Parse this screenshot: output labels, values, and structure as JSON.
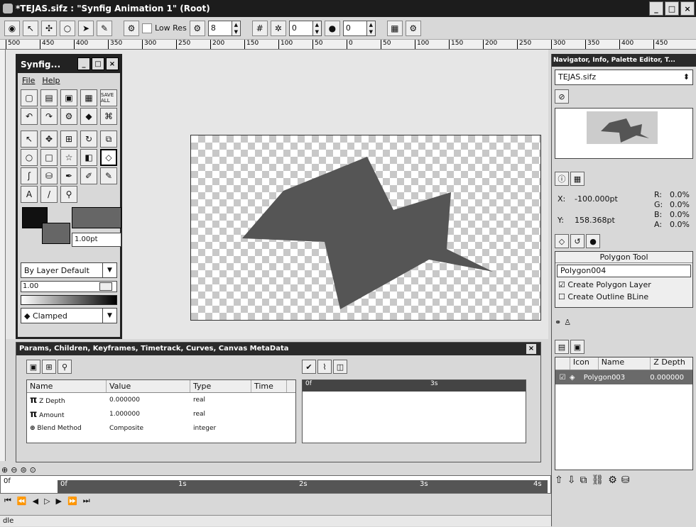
{
  "window": {
    "title": "*TEJAS.sifz : \"Synfig Animation 1\" (Root)",
    "buttons": [
      "_",
      "□",
      "×"
    ]
  },
  "toolbar": {
    "low_res_label": "Low Res",
    "field1": "8",
    "field2": "0",
    "field3": "0"
  },
  "ruler": {
    "ticks": [
      "500",
      "450",
      "400",
      "350",
      "300",
      "250",
      "200",
      "150",
      "100",
      "50",
      "0",
      "50",
      "100",
      "150",
      "200",
      "250",
      "300",
      "350",
      "400",
      "450"
    ]
  },
  "toolbox": {
    "title": "Synfig...",
    "menu": [
      "File",
      "Help"
    ],
    "width_value": "1.00pt",
    "blend": "By Layer Default",
    "opacity": "1.00",
    "interp": "Clamped"
  },
  "params": {
    "title": "Params, Children, Keyframes, Timetrack, Curves, Canvas MetaData",
    "columns": [
      "Name",
      "Value",
      "Type",
      "Time"
    ],
    "rows": [
      {
        "name": "Z Depth",
        "value": "0.000000",
        "type": "real"
      },
      {
        "name": "Amount",
        "value": "1.000000",
        "type": "real"
      },
      {
        "name": "Blend Method",
        "value": "Composite",
        "type": "integer"
      }
    ],
    "timetrack_labels": [
      "0f",
      "3s"
    ]
  },
  "right": {
    "title": "Navigator, Info, Palette Editor, T...",
    "file": "TEJAS.sifz",
    "info": {
      "x_label": "X:",
      "x": "-100.000pt",
      "y_label": "Y:",
      "y": "158.368pt",
      "r": "R:",
      "r_val": "0.0%",
      "g": "G:",
      "g_val": "0.0%",
      "b": "B:",
      "b_val": "0.0%",
      "a": "A:",
      "a_val": "0.0%"
    },
    "tool_title": "Polygon Tool",
    "tool_name": "Polygon004",
    "opt1": "Create Polygon Layer",
    "opt2": "Create Outline BLine",
    "layers_cols": [
      "Icon",
      "Name",
      "Z Depth"
    ],
    "layer_name": "Polygon003",
    "layer_z": "0.000000"
  },
  "timeline": {
    "frame": "0f",
    "labels": [
      "0f",
      "1s",
      "2s",
      "3s",
      "4s"
    ]
  },
  "status": {
    "text": "dle"
  }
}
